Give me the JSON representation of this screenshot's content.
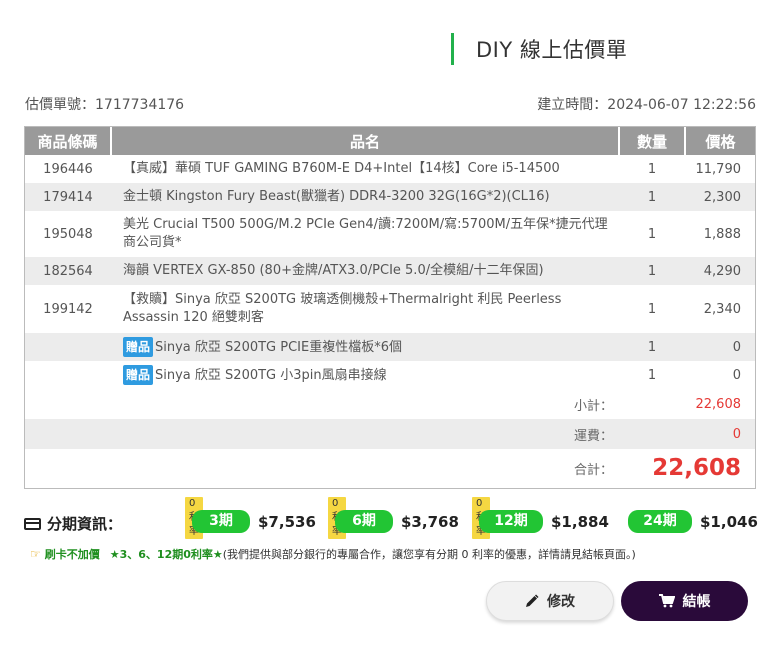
{
  "title": "DIY 線上估價單",
  "meta": {
    "order_no": "估價單號：1717734176",
    "created": "建立時間：2024-06-07 12:22:56"
  },
  "table": {
    "headers": [
      "商品條碼",
      "品名",
      "數量",
      "價格"
    ],
    "rows": [
      {
        "code": "196446",
        "name": "【真威】華碩 TUF GAMING B760M-E D4+Intel【14核】Core i5-14500",
        "qty": "1",
        "price": "11,790"
      },
      {
        "code": "179414",
        "name": "金士頓 Kingston Fury Beast(獸獵者) DDR4-3200 32G(16G*2)(CL16)",
        "qty": "1",
        "price": "2,300"
      },
      {
        "code": "195048",
        "name": "美光 Crucial T500 500G/M.2 PCIe Gen4/讀:7200M/寫:5700M/五年保*捷元代理商公司貨*",
        "qty": "1",
        "price": "1,888"
      },
      {
        "code": "182564",
        "name": "海韻 VERTEX GX-850 (80+金牌/ATX3.0/PCIe 5.0/全模組/十二年保固)",
        "qty": "1",
        "price": "4,290"
      },
      {
        "code": "199142",
        "name": "【救贖】Sinya 欣亞 S200TG 玻璃透側機殼+Thermalright 利民 Peerless Assassin 120 絕雙刺客",
        "qty": "1",
        "price": "2,340"
      }
    ],
    "gifts": [
      {
        "tag": "贈品",
        "name": "Sinya 欣亞 S200TG PCIE重複性檔板*6個",
        "qty": "1",
        "price": "0"
      },
      {
        "tag": "贈品",
        "name": "Sinya 欣亞 S200TG 小3pin風扇串接線",
        "qty": "1",
        "price": "0"
      }
    ],
    "summary": {
      "subtotal_label": "小計：",
      "subtotal": "22,608",
      "shipping_label": "運費：",
      "shipping": "0",
      "total_label": "合計：",
      "total": "22,608"
    }
  },
  "installment": {
    "label": "分期資訊：",
    "plans": [
      {
        "badge": "0利率",
        "period": "3期",
        "amount": "$7,536"
      },
      {
        "badge": "0利率",
        "period": "6期",
        "amount": "$3,768"
      },
      {
        "badge": "0利率",
        "period": "12期",
        "amount": "$1,884"
      },
      {
        "badge": "",
        "period": "24期",
        "amount": "$1,046"
      }
    ]
  },
  "notice": {
    "no_fee": "刷卡不加價",
    "highlight": "★3、6、12期0利率★",
    "text": "(我們提供與部分銀行的專屬合作，讓您享有分期 0 利率的優惠，詳情請見結帳頁面。)"
  },
  "buttons": {
    "edit": "修改",
    "checkout": "結帳"
  },
  "colors": {
    "accent_green": "#22c534",
    "price_red": "#e53935",
    "checkout_bg": "#2a0a3a"
  }
}
